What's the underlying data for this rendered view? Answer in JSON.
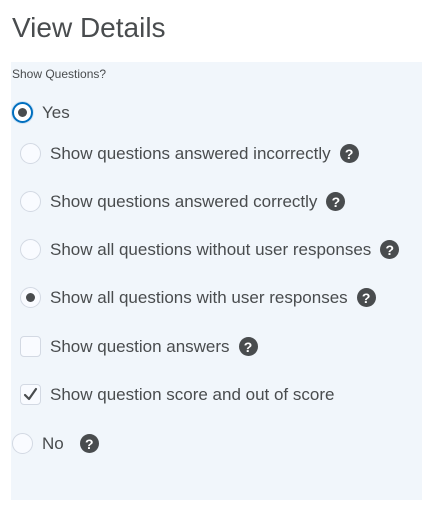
{
  "page": {
    "title": "View Details"
  },
  "show_questions": {
    "label": "Show Questions?",
    "yes_label": "Yes",
    "no_label": "No",
    "options": [
      {
        "label": "Show questions answered incorrectly",
        "type": "radio",
        "selected": false,
        "help": "?"
      },
      {
        "label": "Show questions answered correctly",
        "type": "radio",
        "selected": false,
        "help": "?"
      },
      {
        "label": "Show all questions without user responses",
        "type": "radio",
        "selected": false,
        "help": "?"
      },
      {
        "label": "Show all questions with user responses",
        "type": "radio",
        "selected": true,
        "help": "?"
      },
      {
        "label": "Show question answers",
        "type": "checkbox",
        "checked": false,
        "help": "?"
      },
      {
        "label": "Show question score and out of score",
        "type": "checkbox",
        "checked": true
      }
    ],
    "no_help": "?"
  },
  "colors": {
    "panel_bg": "#f1f6fb",
    "focus": "#006fbf",
    "text": "#494c4e"
  },
  "icons": {
    "help": "question-circle-icon",
    "check": "checkmark-icon"
  }
}
